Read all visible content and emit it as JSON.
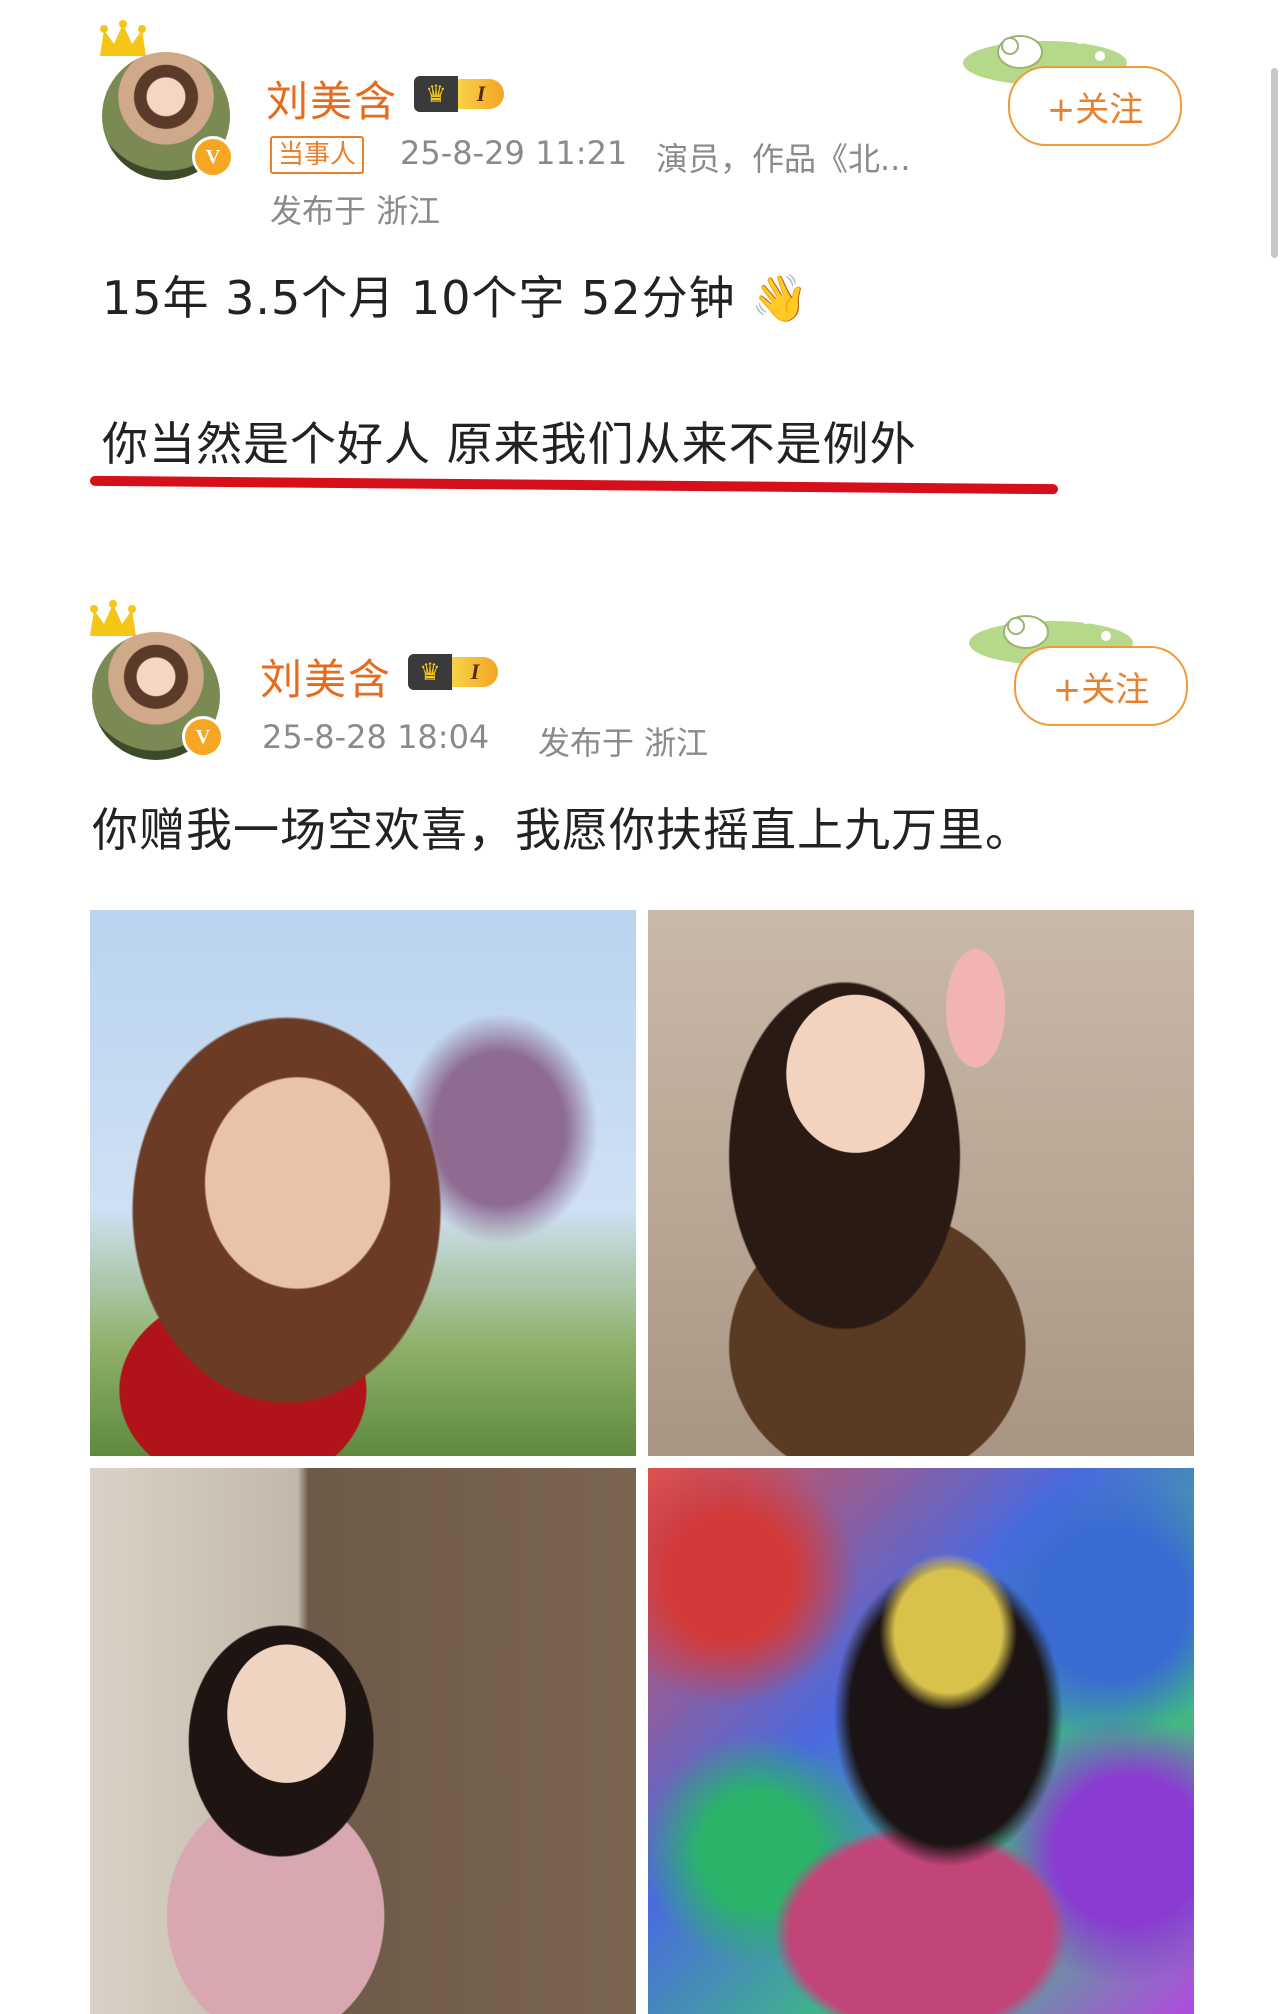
{
  "posts": [
    {
      "user": {
        "name": "刘美含",
        "level": "I",
        "tag": "当事人"
      },
      "timestamp": "25-8-29 11:21",
      "bio": "演员，作品《北...",
      "location": "发布于 浙江",
      "follow_label": "+关注",
      "lines": [
        "15年 3.5个月 10个字 52分钟 👋",
        "你当然是个好人   原来我们从来不是例外"
      ]
    },
    {
      "user": {
        "name": "刘美含",
        "level": "I"
      },
      "timestamp": "25-8-28 18:04",
      "location": "发布于 浙江",
      "follow_label": "+关注",
      "text": "你赠我一场空欢喜，我愿你扶摇直上九万里。",
      "images": [
        "photo-1",
        "photo-2",
        "photo-3",
        "photo-4"
      ]
    }
  ],
  "colors": {
    "name": "#e86b1c",
    "accent": "#f09a3a",
    "underline": "#d6101a",
    "meta": "#8a8a8a"
  }
}
